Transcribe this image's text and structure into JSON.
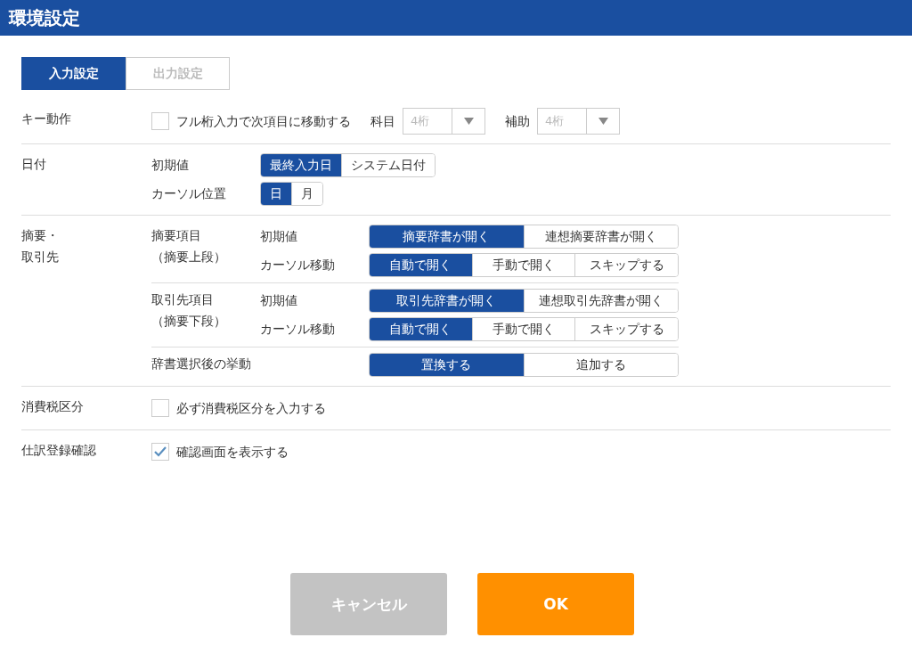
{
  "title": "環境設定",
  "tabs": [
    {
      "label": "入力設定",
      "selected": true
    },
    {
      "label": "出力設定",
      "selected": false
    }
  ],
  "sections": [
    {
      "kind": "checkbox",
      "label_lines": [
        "キー動作"
      ],
      "checkbox": {
        "label": "フル桁入力で次項目に移動する",
        "checked": false
      },
      "selects": [
        {
          "label": "科目",
          "value": "4桁"
        },
        {
          "label": "補助",
          "value": "4桁"
        }
      ]
    },
    {
      "kind": "options",
      "label_lines": [
        "日付"
      ],
      "blocks": [
        {
          "groups": [
            {
              "label": "初期値",
              "options": [
                {
                  "label": "最終入力日",
                  "selected": true
                },
                {
                  "label": "システム日付",
                  "selected": false
                }
              ]
            },
            {
              "label": "カーソル位置",
              "options": [
                {
                  "label": "日",
                  "selected": true
                },
                {
                  "label": "月",
                  "selected": false
                }
              ]
            }
          ]
        }
      ]
    },
    {
      "kind": "nested",
      "label_lines": [
        "摘要・",
        "取引先"
      ],
      "blocks": [
        {
          "label_lines": [
            "摘要項目",
            "（摘要上段）"
          ],
          "groups": [
            {
              "label": "初期値",
              "options": [
                {
                  "label": "摘要辞書が開く",
                  "selected": true
                },
                {
                  "label": "連想摘要辞書が開く",
                  "selected": false
                }
              ]
            },
            {
              "label": "カーソル移動",
              "options": [
                {
                  "label": "自動で開く",
                  "selected": true
                },
                {
                  "label": "手動で開く",
                  "selected": false
                },
                {
                  "label": "スキップする",
                  "selected": false
                }
              ]
            }
          ]
        },
        {
          "label_lines": [
            "取引先項目",
            "（摘要下段）"
          ],
          "groups": [
            {
              "label": "初期値",
              "options": [
                {
                  "label": "取引先辞書が開く",
                  "selected": true
                },
                {
                  "label": "連想取引先辞書が開く",
                  "selected": false
                }
              ]
            },
            {
              "label": "カーソル移動",
              "options": [
                {
                  "label": "自動で開く",
                  "selected": true
                },
                {
                  "label": "手動で開く",
                  "selected": false
                },
                {
                  "label": "スキップする",
                  "selected": false
                }
              ]
            }
          ]
        },
        {
          "label_lines": [
            "辞書選択後の挙動"
          ],
          "groups": [
            {
              "options": [
                {
                  "label": "置換する",
                  "selected": true
                },
                {
                  "label": "追加する",
                  "selected": false
                }
              ]
            }
          ]
        }
      ]
    },
    {
      "kind": "checkbox",
      "label_lines": [
        "消費税区分"
      ],
      "checkbox": {
        "label": "必ず消費税区分を入力する",
        "checked": false
      }
    },
    {
      "kind": "checkbox",
      "label_lines": [
        "仕訳登録確認"
      ],
      "checkbox": {
        "label": "確認画面を表示する",
        "checked": true
      }
    }
  ],
  "buttons": [
    {
      "label": "キャンセル",
      "disabled": true
    },
    {
      "label": "OK",
      "disabled": false
    }
  ]
}
